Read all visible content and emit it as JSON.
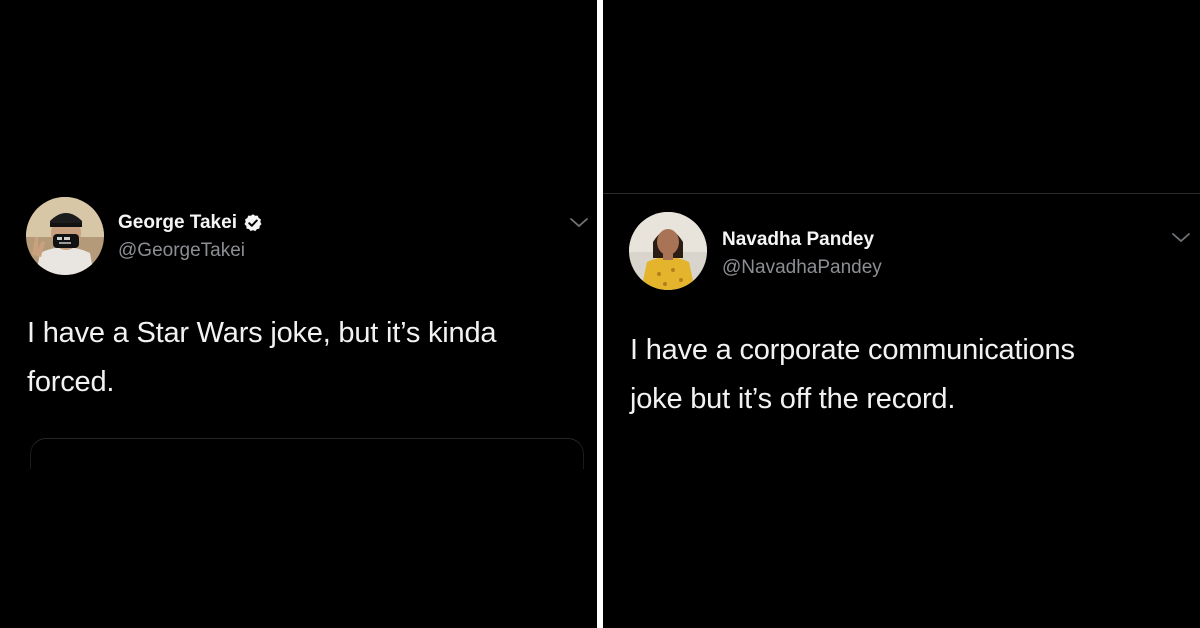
{
  "tweets": [
    {
      "name": "George Takei",
      "handle": "@GeorgeTakei",
      "verified": true,
      "text_line1": "I have a Star Wars joke, but it’s kinda",
      "text_line2": "forced.",
      "avatar": "avatar-man-with-mask"
    },
    {
      "name": "Navadha Pandey",
      "handle": "@NavadhaPandey",
      "verified": false,
      "text_line1": "I have a corporate communications",
      "text_line2": "joke but it’s off the record.",
      "avatar": "avatar-woman-yellow-dress"
    }
  ],
  "colors": {
    "background": "#000000",
    "text": "#f2f2f2",
    "handle": "#8b8f94",
    "divider": "#ffffff"
  },
  "icons": [
    "verified-badge-icon",
    "chevron-down-icon"
  ]
}
